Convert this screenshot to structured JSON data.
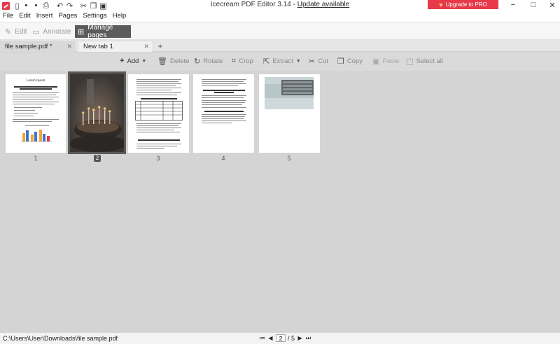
{
  "window": {
    "title_prefix": "Icecream PDF Editor 3.14 - ",
    "update_link": "Update available",
    "upgrade_label": "Upgrade to PRO",
    "minimize": "−",
    "maximize": "□",
    "close": "✕"
  },
  "quick_access": [
    "menu-icon",
    "new-doc-icon",
    "save-icon",
    "save-as-icon",
    "print-icon",
    "undo-icon",
    "redo-icon",
    "cut-icon",
    "copy-icon",
    "paste-icon"
  ],
  "menu": [
    "File",
    "Edit",
    "Insert",
    "Pages",
    "Settings",
    "Help"
  ],
  "modes": {
    "edit": "Edit",
    "annotate": "Annotate",
    "manage": "Manage pages"
  },
  "tabs": [
    {
      "label": "file sample.pdf *"
    },
    {
      "label": "New tab 1"
    }
  ],
  "toolbar": {
    "add": "Add",
    "delete": "Delete",
    "rotate": "Rotate",
    "crop": "Crop",
    "extract": "Extract",
    "cut": "Cut",
    "copy": "Copy",
    "paste": "Paste",
    "select_all": "Select all"
  },
  "pages": [
    {
      "number": "1",
      "doc_title": "Lorem Ipsum"
    },
    {
      "number": "2"
    },
    {
      "number": "3"
    },
    {
      "number": "4"
    },
    {
      "number": "5"
    }
  ],
  "status": {
    "file_path": "C:\\Users\\User\\Downloads\\file sample.pdf",
    "current_page": "2",
    "total_pages": "/ 5"
  },
  "colors": {
    "accent": "#e8394a",
    "mode_active": "#5b5b5b",
    "workspace": "#d4d4d4"
  }
}
